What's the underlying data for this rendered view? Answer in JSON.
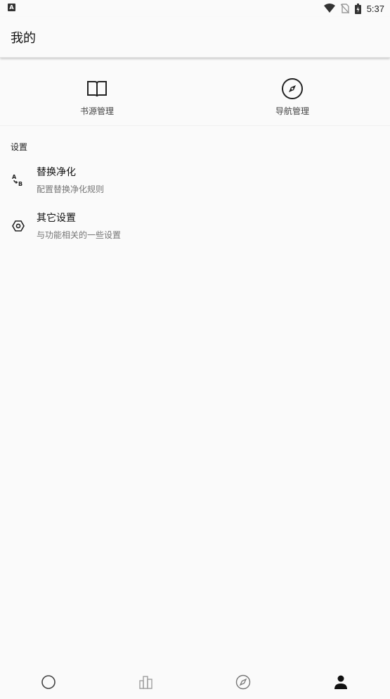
{
  "status_bar": {
    "notification_icon": "A",
    "time": "5:37",
    "icons": [
      "wifi-icon",
      "no-sim-icon",
      "battery-icon"
    ]
  },
  "app_bar": {
    "title": "我的"
  },
  "quick_actions": [
    {
      "label": "书源管理",
      "icon": "book-open-icon"
    },
    {
      "label": "导航管理",
      "icon": "compass-icon"
    }
  ],
  "settings": {
    "section_title": "设置",
    "items": [
      {
        "title": "替换净化",
        "subtitle": "配置替换净化规则",
        "icon": "text-replace-icon"
      },
      {
        "title": "其它设置",
        "subtitle": "与功能相关的一些设置",
        "icon": "settings-gear-icon"
      }
    ]
  },
  "bottom_nav": {
    "items": [
      {
        "icon": "circle-icon",
        "selected": false
      },
      {
        "icon": "bookshelf-icon",
        "selected": false
      },
      {
        "icon": "compass-icon",
        "selected": false
      },
      {
        "icon": "person-icon",
        "selected": true
      }
    ]
  },
  "colors": {
    "background": "#fafafa",
    "text_primary": "#212121",
    "text_secondary": "#757575",
    "icon_inactive": "#9e9e9e"
  }
}
